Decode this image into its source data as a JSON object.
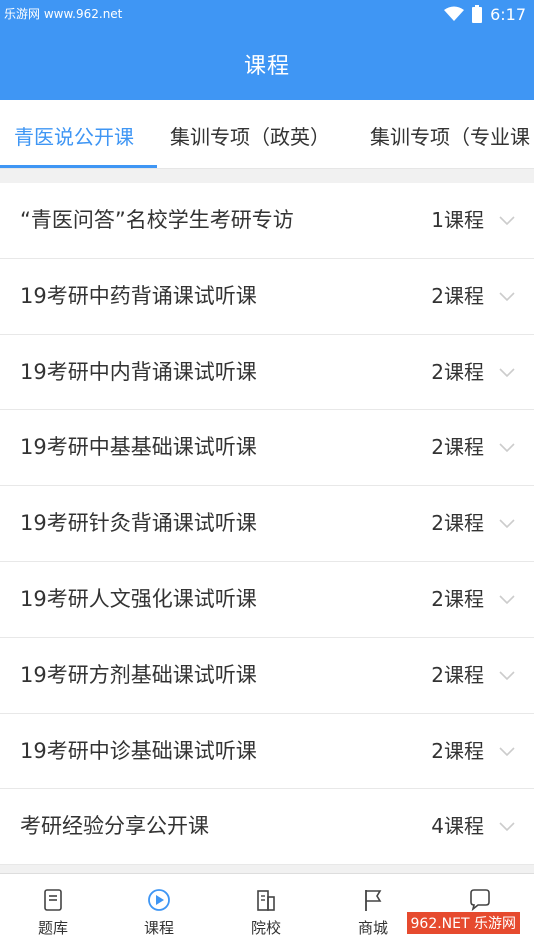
{
  "status_bar": {
    "watermark": "乐游网 www.962.net",
    "time": "6:17"
  },
  "header": {
    "title": "课程"
  },
  "tabs": [
    {
      "label": "青医说公开课",
      "active": true
    },
    {
      "label": "集训专项（政英）",
      "active": false
    },
    {
      "label": "集训专项（专业课",
      "active": false
    }
  ],
  "courses": [
    {
      "title": "“青医问答”名校学生考研专访",
      "count": "1课程"
    },
    {
      "title": "19考研中药背诵课试听课",
      "count": "2课程"
    },
    {
      "title": "19考研中内背诵课试听课",
      "count": "2课程"
    },
    {
      "title": "19考研中基基础课试听课",
      "count": "2课程"
    },
    {
      "title": "19考研针灸背诵课试听课",
      "count": "2课程"
    },
    {
      "title": "19考研人文强化课试听课",
      "count": "2课程"
    },
    {
      "title": "19考研方剂基础课试听课",
      "count": "2课程"
    },
    {
      "title": "19考研中诊基础课试听课",
      "count": "2课程"
    },
    {
      "title": "考研经验分享公开课",
      "count": "4课程"
    }
  ],
  "bottom_nav": [
    {
      "label": "题库",
      "icon": "document-icon"
    },
    {
      "label": "课程",
      "icon": "play-circle-icon"
    },
    {
      "label": "院校",
      "icon": "building-icon"
    },
    {
      "label": "商城",
      "icon": "flag-icon"
    },
    {
      "label": "",
      "icon": "chat-bubble-icon"
    }
  ],
  "watermark_badge": "962.NET 乐游网",
  "colors": {
    "accent": "#3f96f4",
    "background": "#f1f1f1"
  }
}
